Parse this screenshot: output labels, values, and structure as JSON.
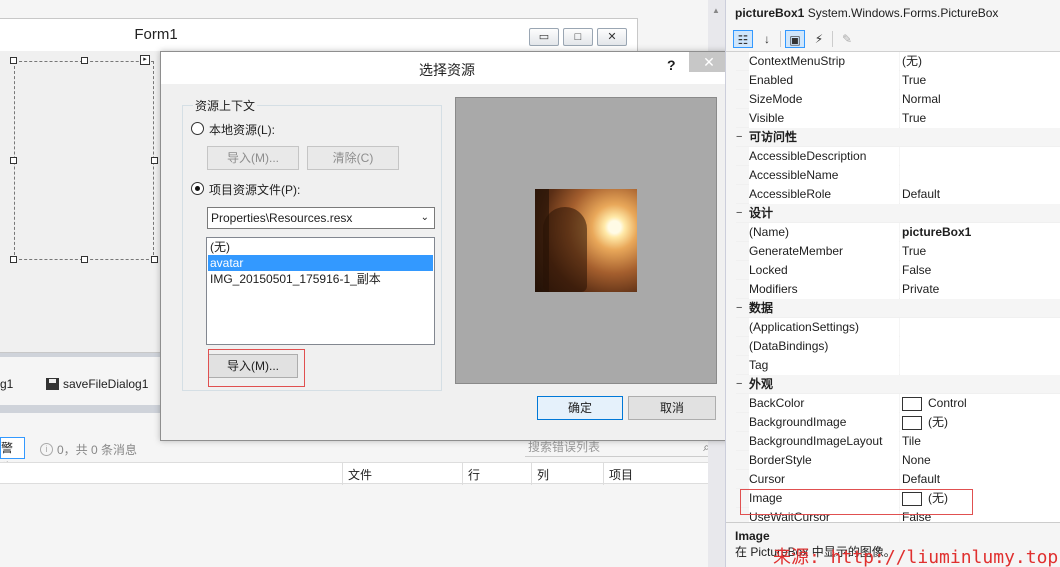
{
  "designer": {
    "form_title": "Form1",
    "form_buttons": {
      "minimize": "▭",
      "maximize": "□",
      "close": "✕"
    },
    "smart_tag": "▸",
    "tray": {
      "item1": "g1",
      "item2": "saveFileDialog1"
    },
    "errorlist": {
      "warn_button": "警告",
      "messages": "0，共 0 条消息",
      "search_placeholder": "搜索错误列表",
      "columns": [
        "文件",
        "行",
        "列",
        "项目"
      ]
    }
  },
  "dialog": {
    "title": "选择资源",
    "help": "?",
    "close": "✕",
    "group_label": "资源上下文",
    "local_radio": "本地资源(L):",
    "import_disabled": "导入(M)...",
    "clear_disabled": "清除(C)",
    "project_radio": "项目资源文件(P):",
    "resfile_selected": "Properties\\Resources.resx",
    "list_items": [
      {
        "label": "(无)",
        "selected": false
      },
      {
        "label": "avatar",
        "selected": true
      },
      {
        "label": "IMG_20150501_175916-1_副本",
        "selected": false
      }
    ],
    "import_button": "导入(M)...",
    "ok_button": "确定",
    "cancel_button": "取消"
  },
  "props": {
    "header_name": "pictureBox1",
    "header_type": "System.Windows.Forms.PictureBox",
    "toolbar": {
      "categorized": "categorized-icon",
      "alphabetical": "alphabetical-icon",
      "properties": "properties-icon",
      "events": "lightning-icon",
      "pages": "wrench-icon"
    },
    "rows": {
      "r0": {
        "name": "ContextMenuStrip",
        "value": "(无)"
      },
      "r1": {
        "name": "Enabled",
        "value": "True"
      },
      "r2": {
        "name": "SizeMode",
        "value": "Normal"
      },
      "r3": {
        "name": "Visible",
        "value": "True"
      },
      "c1": {
        "name": "可访问性"
      },
      "r4": {
        "name": "AccessibleDescription",
        "value": ""
      },
      "r5": {
        "name": "AccessibleName",
        "value": ""
      },
      "r6": {
        "name": "AccessibleRole",
        "value": "Default"
      },
      "c2": {
        "name": "设计"
      },
      "r7": {
        "name": "(Name)",
        "value": "pictureBox1"
      },
      "r8": {
        "name": "GenerateMember",
        "value": "True"
      },
      "r9": {
        "name": "Locked",
        "value": "False"
      },
      "r10": {
        "name": "Modifiers",
        "value": "Private"
      },
      "c3": {
        "name": "数据"
      },
      "r11": {
        "name": "(ApplicationSettings)",
        "value": ""
      },
      "r12": {
        "name": "(DataBindings)",
        "value": ""
      },
      "r13": {
        "name": "Tag",
        "value": ""
      },
      "c4": {
        "name": "外观"
      },
      "r14": {
        "name": "BackColor",
        "value": "Control"
      },
      "r15": {
        "name": "BackgroundImage",
        "value": "(无)"
      },
      "r16": {
        "name": "BackgroundImageLayout",
        "value": "Tile"
      },
      "r17": {
        "name": "BorderStyle",
        "value": "None"
      },
      "r18": {
        "name": "Cursor",
        "value": "Default"
      },
      "r19": {
        "name": "Image",
        "value": "(无)"
      },
      "r20": {
        "name": "UseWaitCursor",
        "value": "False"
      }
    },
    "expander": "−",
    "desc_title": "Image",
    "desc_text": "在 PictureBox 中显示的图像。"
  },
  "watermark": "来源: http://liuminlumy.top",
  "colors": {
    "accent": "#3399ff",
    "highlight": "#e05050"
  }
}
